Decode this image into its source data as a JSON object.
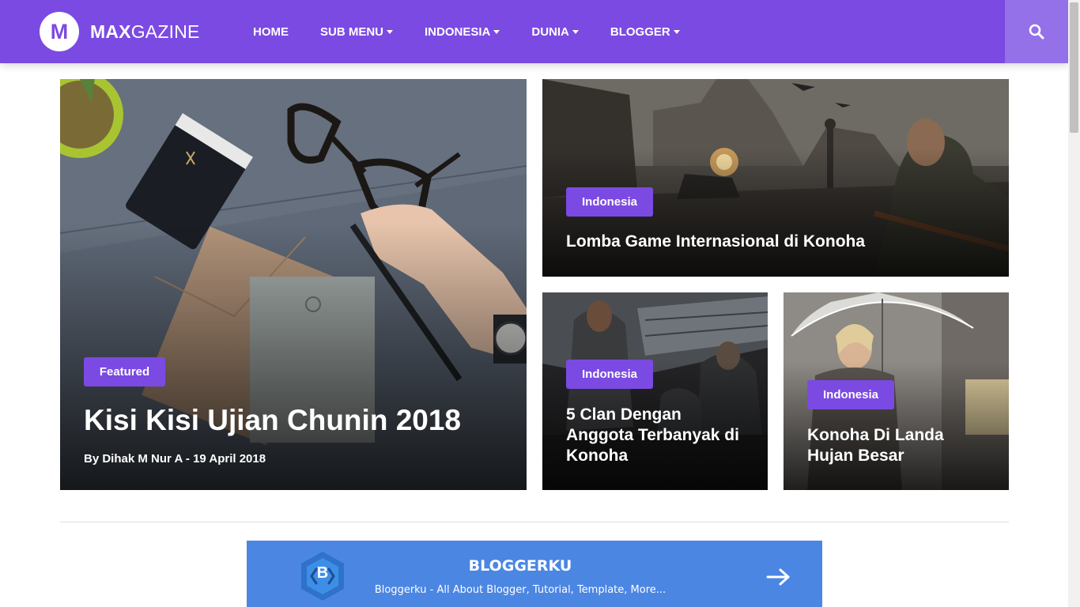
{
  "header": {
    "logo_letter": "M",
    "logo_bold": "MAX",
    "logo_rest": "GAZINE",
    "nav": [
      {
        "label": "HOME",
        "dropdown": false
      },
      {
        "label": "SUB MENU",
        "dropdown": true
      },
      {
        "label": "INDONESIA",
        "dropdown": true
      },
      {
        "label": "DUNIA",
        "dropdown": true
      },
      {
        "label": "BLOGGER",
        "dropdown": true
      }
    ],
    "search_icon": "search-icon"
  },
  "featured": {
    "main": {
      "category": "Featured",
      "title": "Kisi Kisi Ujian Chunin 2018",
      "meta": "By Dihak M Nur A - 19 April 2018"
    },
    "top_right": {
      "category": "Indonesia",
      "title": "Lomba Game Internasional di Konoha"
    },
    "bottom_left": {
      "category": "Indonesia",
      "title": "5 Clan Dengan Anggota Terbanyak di Konoha"
    },
    "bottom_right": {
      "category": "Indonesia",
      "title": "Konoha Di Landa Hujan Besar"
    }
  },
  "banner": {
    "logo_letter": "B",
    "title": "BLOGGERKU",
    "subtitle": "Bloggerku - All About Blogger, Tutorial, Template, More...",
    "arrow_icon": "arrow-right-icon"
  },
  "colors": {
    "brand": "#7b4ae2",
    "search_bg": "#9470e9",
    "banner_bg": "#4b86e3"
  }
}
